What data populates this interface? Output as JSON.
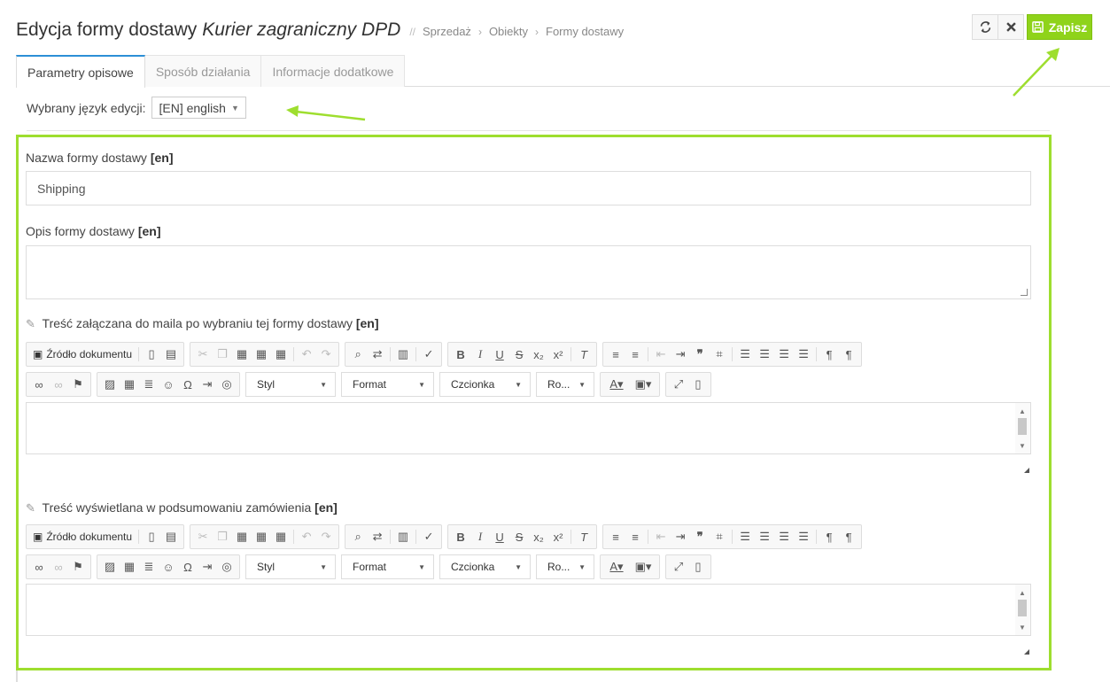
{
  "header": {
    "title": "Edycja formy dostawy",
    "object_name": "Kurier zagraniczny DPD",
    "separator": "//",
    "breadcrumb": [
      "Sprzedaż",
      "Obiekty",
      "Formy dostawy"
    ],
    "crumb_arrow": "›"
  },
  "toolbar": {
    "save_label": "Zapisz"
  },
  "tabs": [
    "Parametry opisowe",
    "Sposób działania",
    "Informacje dodatkowe"
  ],
  "language": {
    "label": "Wybrany język edycji:",
    "value": "[EN] english"
  },
  "fields": {
    "name_label": "Nazwa formy dostawy",
    "name_tag": "[en]",
    "name_value": "Shipping",
    "desc_label": "Opis formy dostawy",
    "desc_tag": "[en]",
    "mail_label": "Treść załączana do maila po wybraniu tej formy dostawy",
    "mail_tag": "[en]",
    "summary_label": "Treść wyświetlana w podsumowaniu zamówienia",
    "summary_tag": "[en]"
  },
  "editor": {
    "source_label": "Źródło dokumentu",
    "style_label": "Styl",
    "format_label": "Format",
    "font_label": "Czcionka",
    "size_label": "Ro..."
  },
  "colors": {
    "accent": "#9ede2f",
    "save": "#8fd31a",
    "tab_active": "#2c8fd6"
  }
}
